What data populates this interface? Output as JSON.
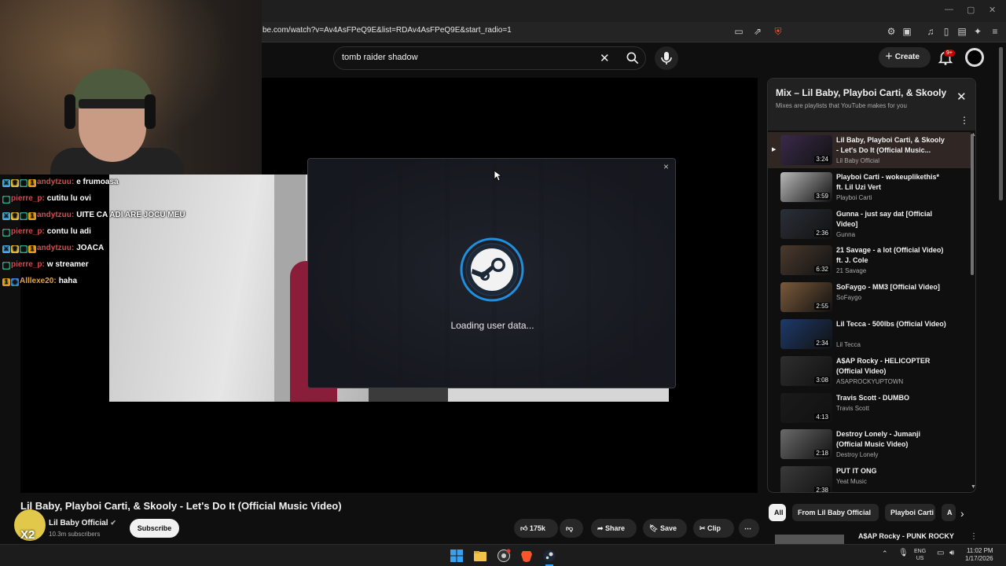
{
  "browser": {
    "url": "be.com/watch?v=Av4AsFPeQ9E&list=RDAv4AsFPeQ9E&start_radio=1"
  },
  "header": {
    "search_value": "tomb raider shadow",
    "create_label": "Create",
    "notif_badge": "9+"
  },
  "chat": [
    {
      "user": "andytzuu:",
      "msg": "e frumoasa",
      "color": "#d94a4a",
      "badges": [
        "sword",
        "crown",
        "grid",
        "one"
      ]
    },
    {
      "user": "pierre_p:",
      "msg": "cutitu lu ovi",
      "color": "#d94a4a",
      "badges": [
        "grid"
      ]
    },
    {
      "user": "andytzuu:",
      "msg": "UITE CA ADI ARE JOCU MEU",
      "color": "#d94a4a",
      "badges": [
        "sword",
        "crown",
        "grid",
        "one"
      ]
    },
    {
      "user": "pierre_p:",
      "msg": "contu lu adi",
      "color": "#d94a4a",
      "badges": [
        "grid"
      ]
    },
    {
      "user": "andytzuu:",
      "msg": "JOACA",
      "color": "#d94a4a",
      "badges": [
        "sword",
        "crown",
        "grid",
        "one"
      ]
    },
    {
      "user": "pierre_p:",
      "msg": "w streamer",
      "color": "#d94a4a",
      "badges": [
        "grid"
      ]
    },
    {
      "user": "Alllexe20:",
      "msg": "haha",
      "color": "#e8a23b",
      "badges": [
        "one",
        "cube"
      ]
    }
  ],
  "steam": {
    "status": "Loading user data...",
    "close": "×"
  },
  "video": {
    "title": "Lil Baby, Playboi Carti, & Skooly - Let's Do It (Official Music Video)",
    "channel": "Lil Baby Official",
    "subscribers": "10.3m subscribers",
    "subscribe_label": "Subscribe",
    "avatar_text": "X2",
    "likes": "175k",
    "share_label": "Share",
    "save_label": "Save",
    "clip_label": "Clip"
  },
  "mix": {
    "title": "Mix – Lil Baby, Playboi Carti, & Skooly",
    "subtitle": "Mixes are playlists that YouTube makes for you",
    "items": [
      {
        "title": "Lil Baby, Playboi Carti, & Skooly - Let's Do It (Official Music...",
        "channel": "Lil Baby Official",
        "duration": "3:24",
        "active": true,
        "thumb": "#3a2a4a"
      },
      {
        "title": "Playboi Carti - wokeuplikethis* ft. Lil Uzi Vert",
        "channel": "Playboi Carti",
        "duration": "3:59",
        "active": false,
        "thumb": "#b8b8b8"
      },
      {
        "title": "Gunna - just say dat [Official Video]",
        "channel": "Gunna",
        "duration": "2:36",
        "active": false,
        "thumb": "#2b3038"
      },
      {
        "title": "21 Savage - a lot (Official Video) ft. J. Cole",
        "channel": "21 Savage",
        "duration": "6:32",
        "active": false,
        "thumb": "#4a3a2e"
      },
      {
        "title": "SoFaygo - MM3 [Official Video]",
        "channel": "SoFaygo",
        "duration": "2:55",
        "active": false,
        "thumb": "#7a5a3a"
      },
      {
        "title": "Lil Tecca - 500lbs (Official Video)",
        "channel": "Lil Tecca",
        "duration": "2:34",
        "active": false,
        "thumb": "#1d3a6a"
      },
      {
        "title": "A$AP Rocky - HELICOPTER (Official Video)",
        "channel": "ASAPROCKYUPTOWN",
        "duration": "3:08",
        "active": false,
        "thumb": "#2e2e2e"
      },
      {
        "title": "Travis Scott - DUMBO",
        "channel": "Travis Scott",
        "duration": "4:13",
        "active": false,
        "thumb": "#1a1a1a"
      },
      {
        "title": "Destroy Lonely - Jumanji (Official Music Video)",
        "channel": "Destroy Lonely",
        "duration": "2:18",
        "active": false,
        "thumb": "#6a6a6a"
      },
      {
        "title": "PUT IT ONG",
        "channel": "Yeat Music",
        "duration": "2:38",
        "active": false,
        "thumb": "#3a3a3a"
      }
    ]
  },
  "chips": [
    "All",
    "From Lil Baby Official",
    "Playboi Carti",
    "A"
  ],
  "next_video_title": "A$AP Rocky - PUNK ROCKY",
  "tray": {
    "lang1": "ENG",
    "lang2": "US",
    "time": "11:02 PM",
    "date": "1/17/2026"
  }
}
